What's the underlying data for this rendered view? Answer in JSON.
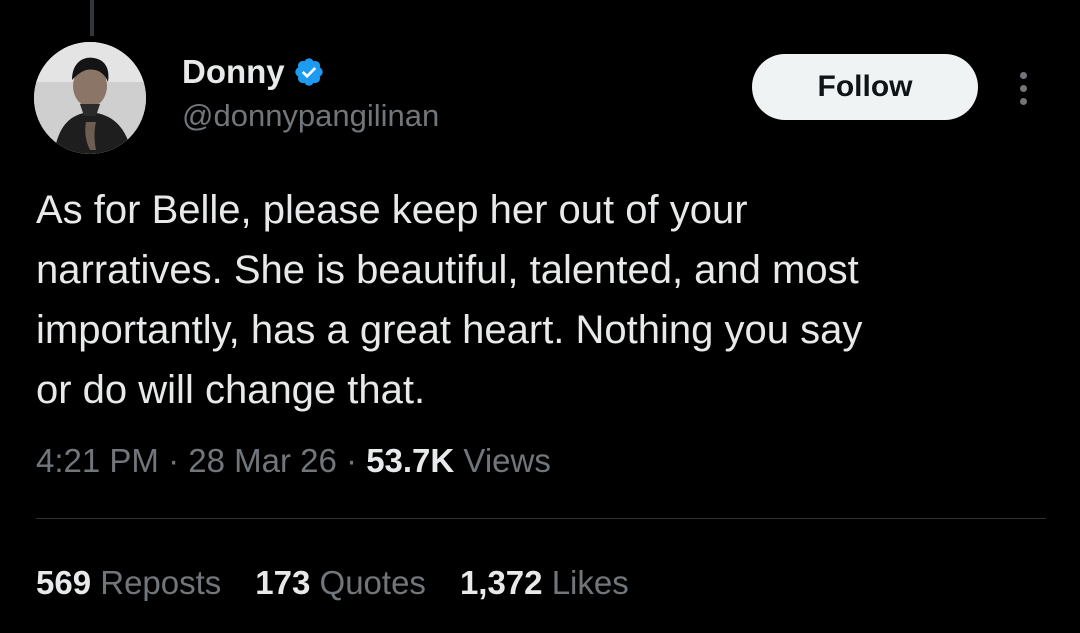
{
  "user": {
    "display_name": "Donny",
    "handle": "@donnypangilinan",
    "verified_icon": "verified-badge-icon",
    "verified_color": "#1d9bf0"
  },
  "actions": {
    "follow_label": "Follow",
    "more_icon": "more-vertical-icon"
  },
  "tweet": {
    "text": "As for Belle, please keep her out of your\nnarratives. She is beautiful, talented, and most\nimportantly, has a great heart. Nothing you say\nor do will change that.",
    "time": "4:21 PM",
    "separator": "·",
    "date": "28 Mar 26",
    "views_count": "53.7K",
    "views_label": "Views"
  },
  "stats": {
    "reposts_count": "569",
    "reposts_label": "Reposts",
    "quotes_count": "173",
    "quotes_label": "Quotes",
    "likes_count": "1,372",
    "likes_label": "Likes"
  },
  "colors": {
    "background": "#000000",
    "primary_text": "#e7e9ea",
    "secondary_text": "#71767b",
    "follow_button_bg": "#eff3f4",
    "divider": "#2f3336"
  }
}
